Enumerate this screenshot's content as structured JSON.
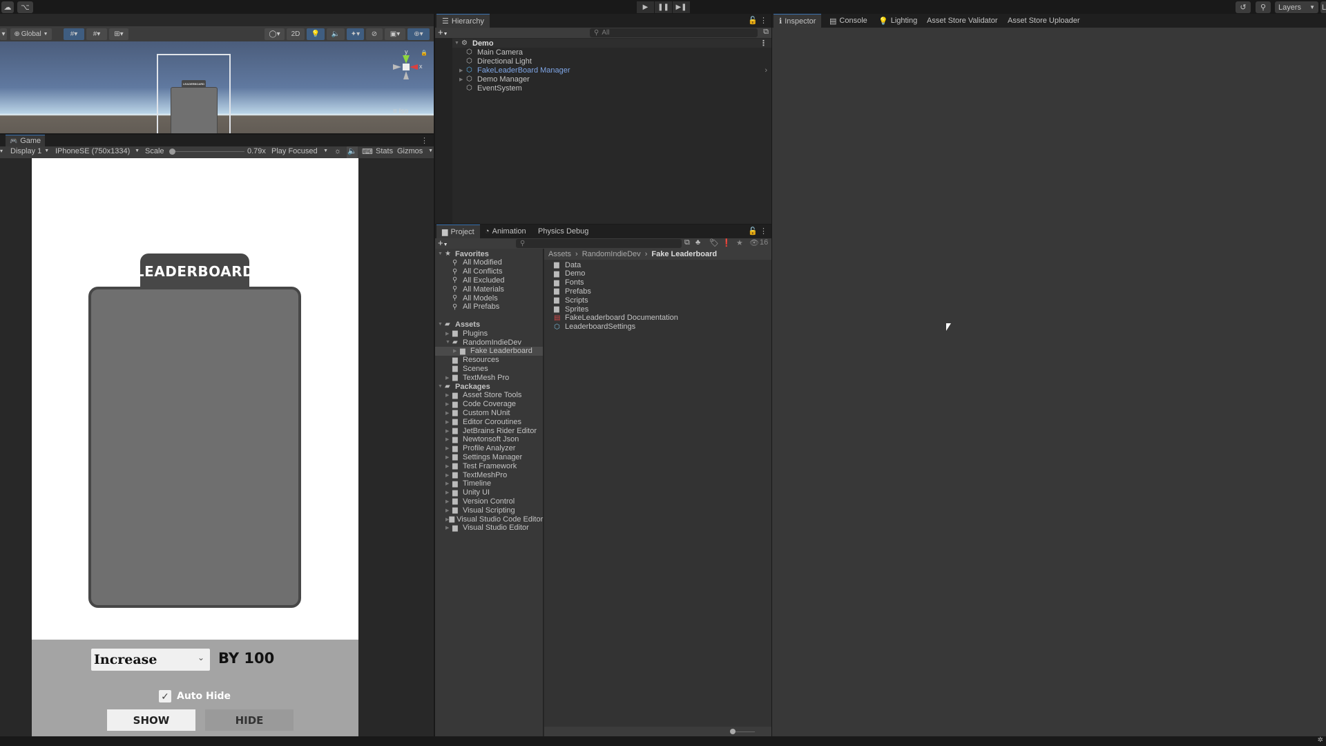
{
  "topbar": {
    "cloud_icon": "cloud-icon",
    "collab_icon": "collab-icon",
    "play": "▶",
    "pause": "❚❚",
    "step": "▶❚",
    "history_icon": "history-icon",
    "search_icon": "search-icon",
    "layers_label": "Layers",
    "layout_label": "L"
  },
  "scene": {
    "toolbar": {
      "pivot_label": "Global",
      "toggle_2d": "2D",
      "iso_label": "Iso",
      "gizmo_y": "y",
      "gizmo_x": "x"
    },
    "lb_mini_label": "LEADERBOARD"
  },
  "game": {
    "tab_label": "Game",
    "display": "Display 1",
    "resolution": "IPhoneSE (750x1334)",
    "scale_label": "Scale",
    "scale_value": "0.79x",
    "play_mode": "Play Focused",
    "stats": "Stats",
    "gizmos": "Gizmos",
    "leaderboard_title": "LEADERBOARD",
    "dropdown_value": "Increase",
    "by_label": "BY 100",
    "auto_hide_label": "Auto Hide",
    "auto_hide_checked": true,
    "show_button": "SHOW",
    "hide_button": "HIDE"
  },
  "hierarchy": {
    "tab_label": "Hierarchy",
    "search_placeholder": "All",
    "scene_name": "Demo",
    "items": [
      {
        "label": "Main Camera",
        "expandable": false,
        "highlight": false
      },
      {
        "label": "Directional Light",
        "expandable": false,
        "highlight": false
      },
      {
        "label": "FakeLeaderBoard Manager",
        "expandable": true,
        "highlight": true
      },
      {
        "label": "Demo Manager",
        "expandable": true,
        "highlight": false
      },
      {
        "label": "EventSystem",
        "expandable": false,
        "highlight": false
      }
    ]
  },
  "project": {
    "tabs": [
      "Project",
      "Animation",
      "Physics Debug"
    ],
    "hidden_count": "16",
    "favorites_label": "Favorites",
    "favorites": [
      "All Modified",
      "All Conflicts",
      "All Excluded",
      "All Materials",
      "All Models",
      "All Prefabs"
    ],
    "assets_label": "Assets",
    "assets_tree": [
      {
        "label": "Plugins",
        "depth": 1,
        "arrow": "right"
      },
      {
        "label": "RandomIndieDev",
        "depth": 1,
        "arrow": "down"
      },
      {
        "label": "Fake Leaderboard",
        "depth": 2,
        "arrow": "right",
        "selected": true
      },
      {
        "label": "Resources",
        "depth": 1,
        "arrow": ""
      },
      {
        "label": "Scenes",
        "depth": 1,
        "arrow": ""
      },
      {
        "label": "TextMesh Pro",
        "depth": 1,
        "arrow": "right"
      }
    ],
    "packages_label": "Packages",
    "packages": [
      "Asset Store Tools",
      "Code Coverage",
      "Custom NUnit",
      "Editor Coroutines",
      "JetBrains Rider Editor",
      "Newtonsoft Json",
      "Profile Analyzer",
      "Settings Manager",
      "Test Framework",
      "TextMeshPro",
      "Timeline",
      "Unity UI",
      "Version Control",
      "Visual Scripting",
      "Visual Studio Code Editor",
      "Visual Studio Editor"
    ],
    "breadcrumb": [
      "Assets",
      "RandomIndieDev",
      "Fake Leaderboard"
    ],
    "contents": [
      {
        "label": "Data",
        "type": "folder"
      },
      {
        "label": "Demo",
        "type": "folder"
      },
      {
        "label": "Fonts",
        "type": "folder"
      },
      {
        "label": "Prefabs",
        "type": "folder"
      },
      {
        "label": "Scripts",
        "type": "folder"
      },
      {
        "label": "Sprites",
        "type": "folder"
      },
      {
        "label": "FakeLeaderboard Documentation",
        "type": "pdf"
      },
      {
        "label": "LeaderboardSettings",
        "type": "scriptable-object"
      }
    ]
  },
  "inspector": {
    "tabs": [
      "Inspector",
      "Console",
      "Lighting",
      "Asset Store Validator",
      "Asset Store Uploader"
    ]
  }
}
